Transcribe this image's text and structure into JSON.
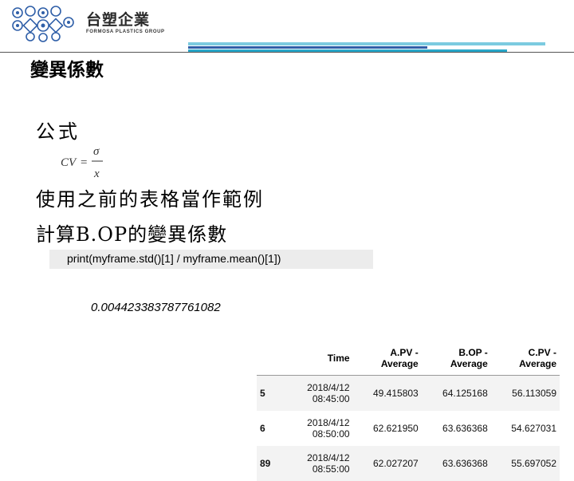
{
  "header": {
    "brand_name": "台塑企業",
    "brand_subtitle": "FORMOSA PLASTICS GROUP",
    "logo_icon": "formosa-group-emblem-icon",
    "colors": {
      "bar_light": "#7ccbe0",
      "bar_dark": "#2f5fa8",
      "bar_mid": "#27a6c9",
      "logo_blue": "#2f5fa8"
    }
  },
  "slide": {
    "title": "變異係數",
    "formula_label": "公式",
    "formula": {
      "lhs": "CV",
      "numerator": "σ",
      "denominator": "x"
    },
    "line1": "使用之前的表格當作範例",
    "line2": "計算B.OP的變異係數",
    "code": "print(myframe.std()[1] / myframe.mean()[1])",
    "result": "0.004423383787761082"
  },
  "table": {
    "columns": [
      "",
      "Time",
      "A.PV - Average",
      "B.OP - Average",
      "C.PV - Average"
    ],
    "rows": [
      {
        "index": "5",
        "time": "2018/4/12 08:45:00",
        "a": "49.415803",
        "b": "64.125168",
        "c": "56.113059"
      },
      {
        "index": "6",
        "time": "2018/4/12 08:50:00",
        "a": "62.621950",
        "b": "63.636368",
        "c": "54.627031"
      },
      {
        "index": "89",
        "time": "2018/4/12 08:55:00",
        "a": "62.027207",
        "b": "63.636368",
        "c": "55.697052"
      }
    ]
  }
}
